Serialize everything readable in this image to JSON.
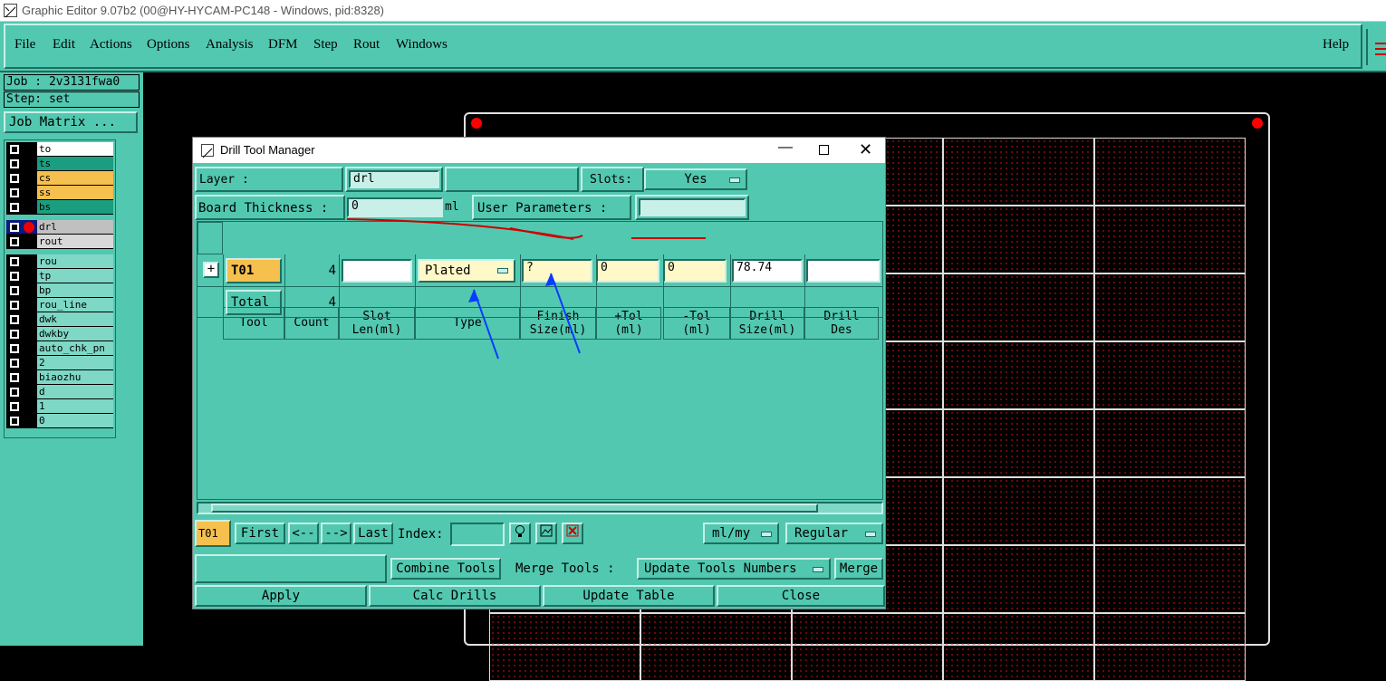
{
  "window": {
    "title": "Graphic Editor 9.07b2 (00@HY-HYCAM-PC148 - Windows, pid:8328)"
  },
  "menu": {
    "items": [
      "File",
      "Edit",
      "Actions",
      "Options",
      "Analysis",
      "DFM",
      "Step",
      "Rout",
      "Windows"
    ],
    "help": "Help"
  },
  "job": {
    "job_line": "Job : 2v3131fwa0",
    "step_line": "Step: set",
    "matrix_button": "Job Matrix ..."
  },
  "layers": {
    "group1": [
      {
        "name": "to",
        "color": "#ffffff"
      },
      {
        "name": "ts",
        "color": "#1b9d80"
      },
      {
        "name": "cs",
        "color": "#f6c04e"
      },
      {
        "name": "ss",
        "color": "#f6c04e"
      },
      {
        "name": "bs",
        "color": "#1b9d80"
      }
    ],
    "group2": [
      {
        "name": "drl",
        "color": "#c0c0c0"
      },
      {
        "name": "rout",
        "color": "#d8d8d8"
      }
    ],
    "group3": [
      {
        "name": "rou"
      },
      {
        "name": "tp"
      },
      {
        "name": "bp"
      },
      {
        "name": "rou_line"
      },
      {
        "name": "dwk"
      },
      {
        "name": "dwkby"
      },
      {
        "name": "auto_chk_pn"
      },
      {
        "name": "2"
      },
      {
        "name": "biaozhu"
      },
      {
        "name": "d"
      },
      {
        "name": "1"
      },
      {
        "name": "0"
      }
    ]
  },
  "dialog": {
    "title": "Drill Tool Manager",
    "layer_label": "Layer          :",
    "layer_value": "drl",
    "slots_label": "Slots:",
    "slots_value": "Yes",
    "board_thickness_label": "Board Thickness :",
    "board_thickness_value": "0",
    "board_thickness_unit": "ml",
    "user_params_label": "User Parameters :",
    "columns": [
      {
        "l1": "Tool",
        "l2": ""
      },
      {
        "l1": "Count",
        "l2": ""
      },
      {
        "l1": "Slot",
        "l2": "Len(ml)"
      },
      {
        "l1": "Type",
        "l2": ""
      },
      {
        "l1": "Finish",
        "l2": "Size(ml)"
      },
      {
        "l1": "+Tol",
        "l2": "(ml)"
      },
      {
        "l1": "-Tol",
        "l2": "(ml)"
      },
      {
        "l1": "Drill",
        "l2": "Size(ml)"
      },
      {
        "l1": "Drill",
        "l2": "Des"
      }
    ],
    "row": {
      "expander": "+",
      "tool": "T01",
      "count": "4",
      "slot_len": "",
      "type": "Plated",
      "finish": "?",
      "plus_tol": "0",
      "minus_tol": "0",
      "drill_size": "78.74",
      "drill_des": ""
    },
    "total": {
      "label": "Total",
      "count": "4"
    },
    "nav": {
      "current": "T01",
      "first": "First",
      "prev": "<--",
      "next": "-->",
      "last": "Last",
      "index_label": "Index:",
      "index_value": "",
      "units": "ml/my",
      "mode": "Regular"
    },
    "combine_tools": "Combine Tools",
    "merge_tools_label": "Merge Tools :",
    "merge_mode": "Update Tools Numbers",
    "merge_button": "Merge",
    "apply": "Apply",
    "calc_drills": "Calc Drills",
    "update_table": "Update Table",
    "close": "Close"
  }
}
